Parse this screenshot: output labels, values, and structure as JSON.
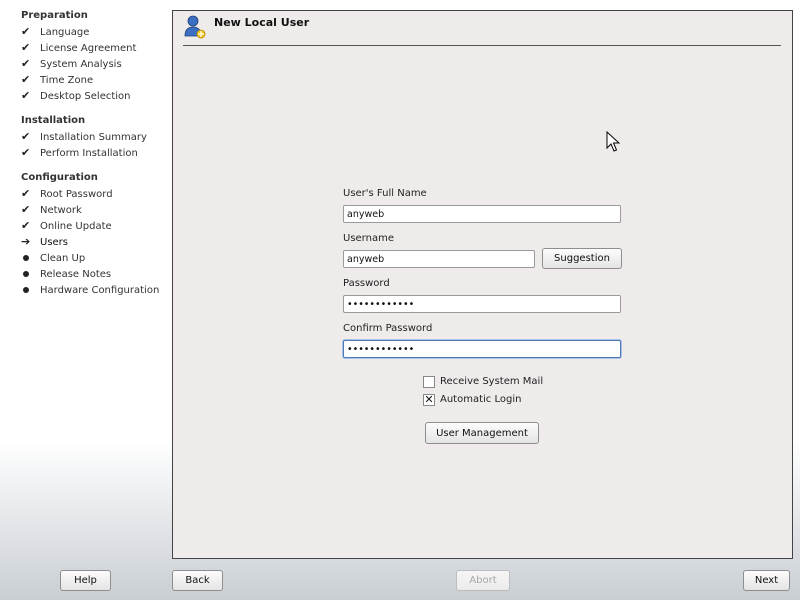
{
  "sidebar": {
    "sections": [
      {
        "title": "Preparation",
        "steps": [
          {
            "label": "Language",
            "state": "done"
          },
          {
            "label": "License Agreement",
            "state": "done"
          },
          {
            "label": "System Analysis",
            "state": "done"
          },
          {
            "label": "Time Zone",
            "state": "done"
          },
          {
            "label": "Desktop Selection",
            "state": "done"
          }
        ]
      },
      {
        "title": "Installation",
        "steps": [
          {
            "label": "Installation Summary",
            "state": "done"
          },
          {
            "label": "Perform Installation",
            "state": "done"
          }
        ]
      },
      {
        "title": "Configuration",
        "steps": [
          {
            "label": "Root Password",
            "state": "done"
          },
          {
            "label": "Network",
            "state": "done"
          },
          {
            "label": "Online Update",
            "state": "done"
          },
          {
            "label": "Users",
            "state": "current"
          },
          {
            "label": "Clean Up",
            "state": "pending"
          },
          {
            "label": "Release Notes",
            "state": "pending"
          },
          {
            "label": "Hardware Configuration",
            "state": "pending"
          }
        ]
      }
    ],
    "icons": {
      "done": "checkmark-icon",
      "current": "arrow-right-icon",
      "pending": "bullet-icon"
    }
  },
  "dialog": {
    "title": "New Local User",
    "icon": "user-add-icon",
    "form": {
      "full_name_label": "User's Full Name",
      "full_name_value": "anyweb",
      "username_label": "Username",
      "username_value": "anyweb",
      "suggestion_button": "Suggestion",
      "password_label": "Password",
      "password_value": "anywebanyweb",
      "confirm_label": "Confirm Password",
      "confirm_value": "anywebanyweb",
      "receive_mail_label": "Receive System Mail",
      "receive_mail_checked": false,
      "auto_login_label": "Automatic Login",
      "auto_login_checked": true,
      "user_mgmt_button": "User Management"
    }
  },
  "footer": {
    "help": "Help",
    "back": "Back",
    "abort": "Abort",
    "next": "Next"
  },
  "colors": {
    "focus_border": "#4e79b8",
    "panel_bg": "#efebeb"
  }
}
